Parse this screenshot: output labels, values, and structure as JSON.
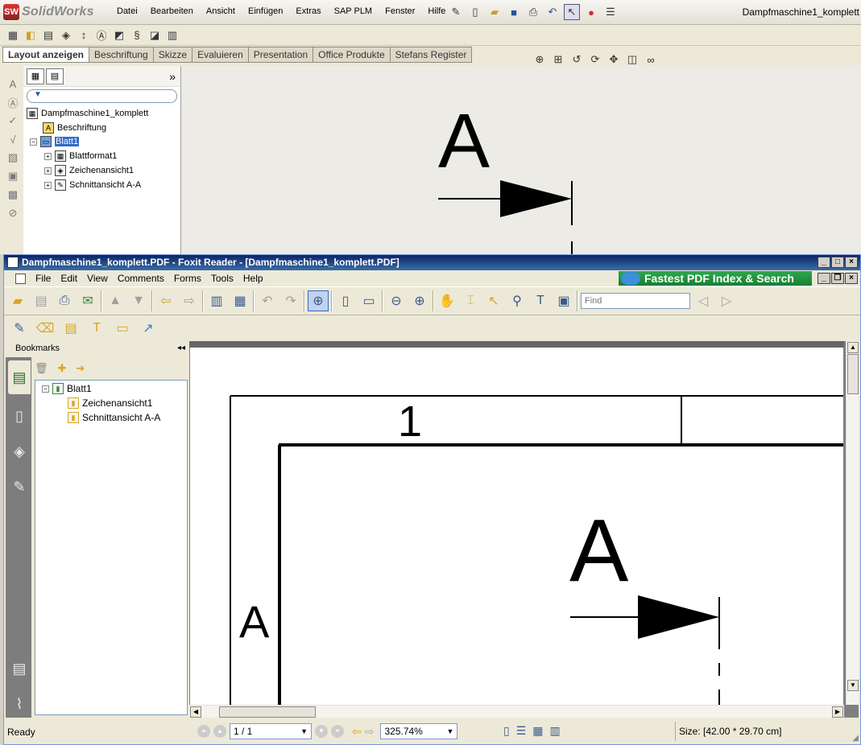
{
  "solidworks": {
    "logo": "SolidWorks",
    "menus": [
      "Datei",
      "Bearbeiten",
      "Ansicht",
      "Einfügen",
      "Extras",
      "SAP PLM",
      "Fenster",
      "Hilfe"
    ],
    "doc_title": "Dampfmaschine1_komplett",
    "tabs": [
      "Layout anzeigen",
      "Beschriftung",
      "Skizze",
      "Evaluieren",
      "Presentation",
      "Office Produkte",
      "Stefans Register"
    ],
    "tree": {
      "root": "Dampfmaschine1_komplett",
      "annotations": "Beschriftung",
      "sheet": "Blatt1",
      "children": [
        "Blattformat1",
        "Zeichenansicht1",
        "Schnittansicht A-A"
      ]
    },
    "canvas_label": "A"
  },
  "foxit": {
    "title": "Dampfmaschine1_komplett.PDF - Foxit Reader - [Dampfmaschine1_komplett.PDF]",
    "menus": [
      "File",
      "Edit",
      "View",
      "Comments",
      "Forms",
      "Tools",
      "Help"
    ],
    "ad_text": "Fastest PDF Index & Search",
    "find_placeholder": "Find",
    "sidebar_title": "Bookmarks",
    "bookmarks": {
      "root": "Blatt1",
      "children": [
        "Zeichenansicht1",
        "Schnittansicht A-A"
      ]
    },
    "page": {
      "zone_number": "1",
      "zone_letter": "A",
      "section_label": "A"
    },
    "status": {
      "ready": "Ready",
      "page": "1 / 1",
      "zoom": "325.74%",
      "size": "Size: [42.00 * 29.70 cm]"
    }
  }
}
